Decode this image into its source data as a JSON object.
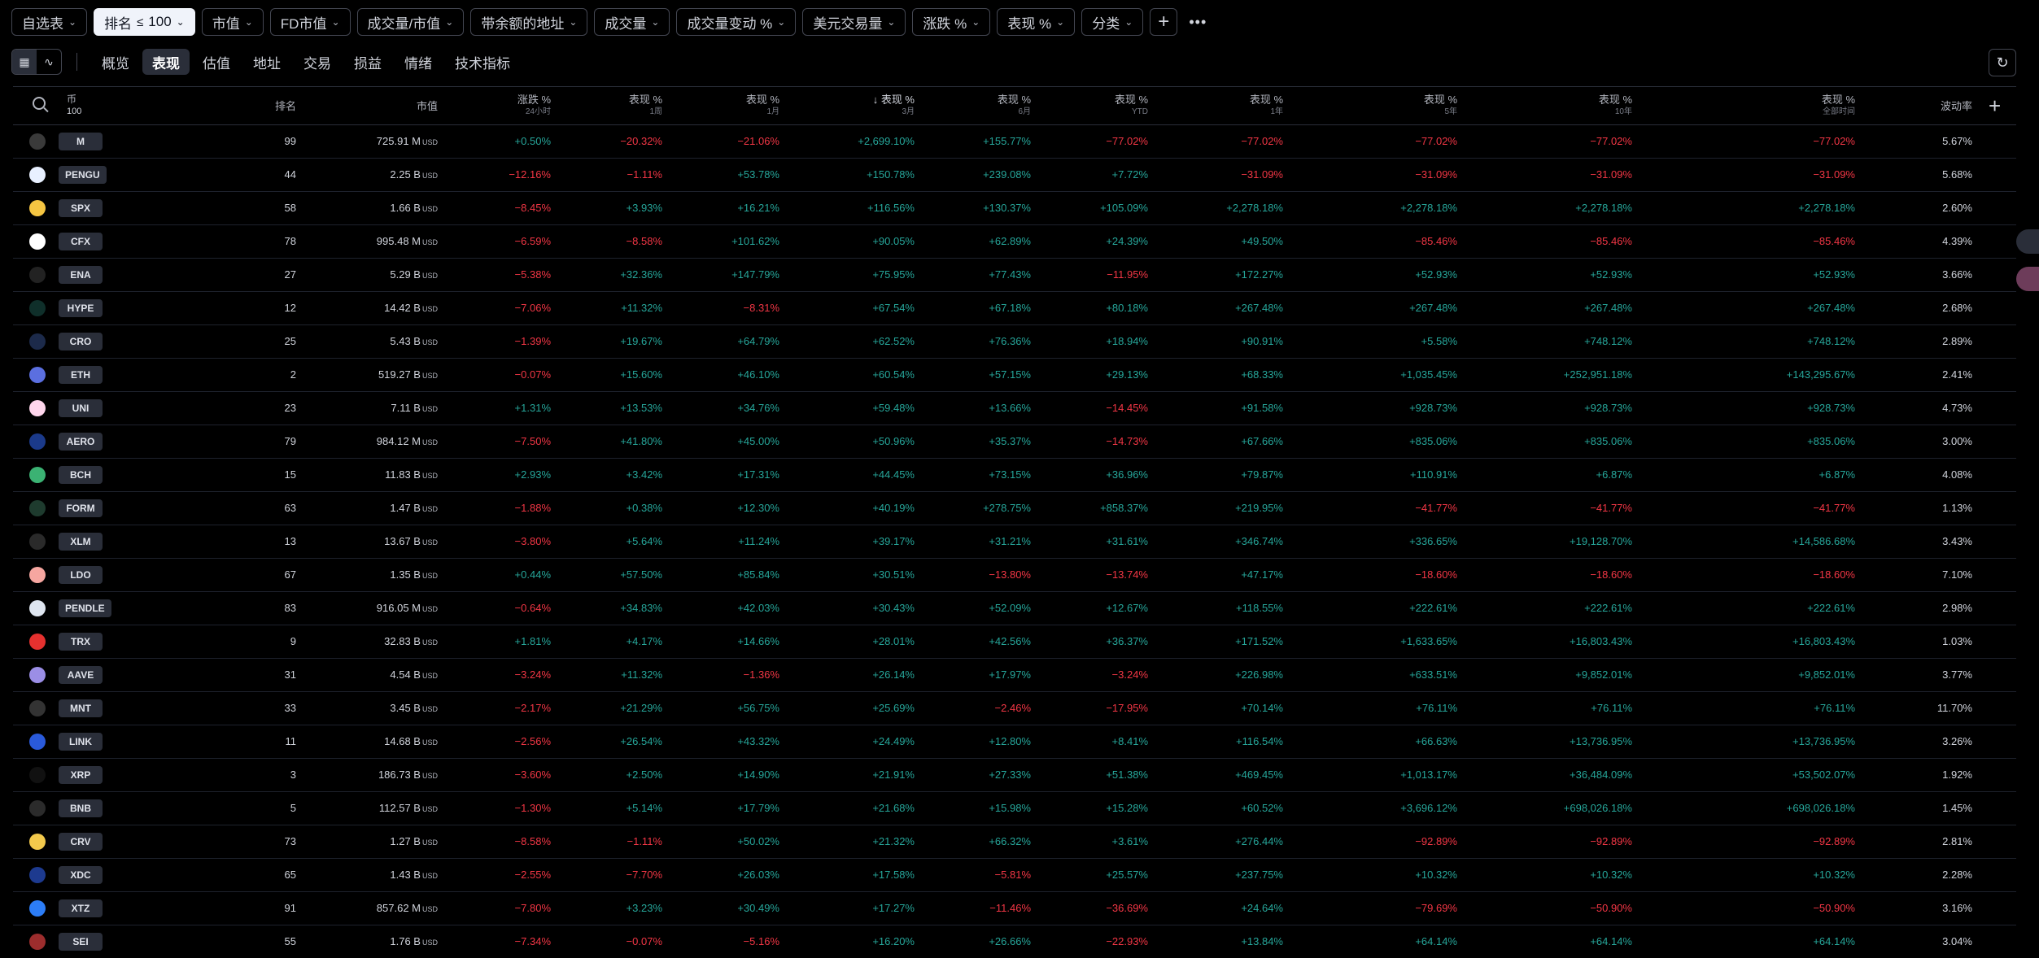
{
  "filters": [
    {
      "key": "watchlist",
      "label": "自选表"
    },
    {
      "key": "rank",
      "label": "排名",
      "sym": "≤",
      "value": "100",
      "active": true
    },
    {
      "key": "mcap",
      "label": "市值"
    },
    {
      "key": "fdv",
      "label": "FD市值"
    },
    {
      "key": "volmcap",
      "label": "成交量/市值"
    },
    {
      "key": "addrbal",
      "label": "带余额的地址"
    },
    {
      "key": "volume",
      "label": "成交量"
    },
    {
      "key": "volchg",
      "label": "成交量变动 %"
    },
    {
      "key": "usdvol",
      "label": "美元交易量"
    },
    {
      "key": "chg",
      "label": "涨跌 %"
    },
    {
      "key": "perf",
      "label": "表现 %"
    },
    {
      "key": "category",
      "label": "分类"
    }
  ],
  "tabs": [
    "概览",
    "表现",
    "估值",
    "地址",
    "交易",
    "损益",
    "情绪",
    "技术指标"
  ],
  "active_tab": 1,
  "headers": {
    "coin": {
      "label": "币",
      "sub": "100"
    },
    "rank": "排名",
    "mcap": "市值",
    "chg": {
      "label": "涨跌 %",
      "sub": "24小时"
    },
    "w1": {
      "label": "表现 %",
      "sub": "1周"
    },
    "m1": {
      "label": "表现 %",
      "sub": "1月"
    },
    "m3": {
      "label": "↓ 表现 %",
      "sub": "3月"
    },
    "m6": {
      "label": "表现 %",
      "sub": "6月"
    },
    "ytd": {
      "label": "表现 %",
      "sub": "YTD"
    },
    "y1": {
      "label": "表现 %",
      "sub": "1年"
    },
    "y5": {
      "label": "表现 %",
      "sub": "5年"
    },
    "y10": {
      "label": "表现 %",
      "sub": "10年"
    },
    "all": {
      "label": "表现 %",
      "sub": "全部时间"
    },
    "vol": "波动率"
  },
  "unit": "USD",
  "rows": [
    {
      "t": "M",
      "c": "#3a3a3a",
      "r": "99",
      "mc": "725.91 M",
      "p": [
        "+0.50%",
        "−20.32%",
        "−21.06%",
        "+2,699.10%",
        "+155.77%",
        "−77.02%",
        "−77.02%",
        "−77.02%",
        "−77.02%",
        "−77.02%"
      ],
      "v": "5.67%"
    },
    {
      "t": "PENGU",
      "c": "#e8f0ff",
      "r": "44",
      "mc": "2.25 B",
      "p": [
        "−12.16%",
        "−1.11%",
        "+53.78%",
        "+150.78%",
        "+239.08%",
        "+7.72%",
        "−31.09%",
        "−31.09%",
        "−31.09%",
        "−31.09%"
      ],
      "v": "5.68%"
    },
    {
      "t": "SPX",
      "c": "#f5c542",
      "r": "58",
      "mc": "1.66 B",
      "p": [
        "−8.45%",
        "+3.93%",
        "+16.21%",
        "+116.56%",
        "+130.37%",
        "+105.09%",
        "+2,278.18%",
        "+2,278.18%",
        "+2,278.18%",
        "+2,278.18%"
      ],
      "v": "2.60%"
    },
    {
      "t": "CFX",
      "c": "#ffffff",
      "r": "78",
      "mc": "995.48 M",
      "p": [
        "−6.59%",
        "−8.58%",
        "+101.62%",
        "+90.05%",
        "+62.89%",
        "+24.39%",
        "+49.50%",
        "−85.46%",
        "−85.46%",
        "−85.46%"
      ],
      "v": "4.39%"
    },
    {
      "t": "ENA",
      "c": "#222222",
      "r": "27",
      "mc": "5.29 B",
      "p": [
        "−5.38%",
        "+32.36%",
        "+147.79%",
        "+75.95%",
        "+77.43%",
        "−11.95%",
        "+172.27%",
        "+52.93%",
        "+52.93%",
        "+52.93%"
      ],
      "v": "3.66%"
    },
    {
      "t": "HYPE",
      "c": "#0f2f2a",
      "r": "12",
      "mc": "14.42 B",
      "p": [
        "−7.06%",
        "+11.32%",
        "−8.31%",
        "+67.54%",
        "+67.18%",
        "+80.18%",
        "+267.48%",
        "+267.48%",
        "+267.48%",
        "+267.48%"
      ],
      "v": "2.68%"
    },
    {
      "t": "CRO",
      "c": "#1c2a4a",
      "r": "25",
      "mc": "5.43 B",
      "p": [
        "−1.39%",
        "+19.67%",
        "+64.79%",
        "+62.52%",
        "+76.36%",
        "+18.94%",
        "+90.91%",
        "+5.58%",
        "+748.12%",
        "+748.12%"
      ],
      "v": "2.89%"
    },
    {
      "t": "ETH",
      "c": "#5b6fe0",
      "r": "2",
      "mc": "519.27 B",
      "p": [
        "−0.07%",
        "+15.60%",
        "+46.10%",
        "+60.54%",
        "+57.15%",
        "+29.13%",
        "+68.33%",
        "+1,035.45%",
        "+252,951.18%",
        "+143,295.67%"
      ],
      "v": "2.41%"
    },
    {
      "t": "UNI",
      "c": "#ffd6ec",
      "r": "23",
      "mc": "7.11 B",
      "p": [
        "+1.31%",
        "+13.53%",
        "+34.76%",
        "+59.48%",
        "+13.66%",
        "−14.45%",
        "+91.58%",
        "+928.73%",
        "+928.73%",
        "+928.73%"
      ],
      "v": "4.73%"
    },
    {
      "t": "AERO",
      "c": "#1b3a8a",
      "r": "79",
      "mc": "984.12 M",
      "p": [
        "−7.50%",
        "+41.80%",
        "+45.00%",
        "+50.96%",
        "+35.37%",
        "−14.73%",
        "+67.66%",
        "+835.06%",
        "+835.06%",
        "+835.06%"
      ],
      "v": "3.00%"
    },
    {
      "t": "BCH",
      "c": "#3bb273",
      "r": "15",
      "mc": "11.83 B",
      "p": [
        "+2.93%",
        "+3.42%",
        "+17.31%",
        "+44.45%",
        "+73.15%",
        "+36.96%",
        "+79.87%",
        "+110.91%",
        "+6.87%",
        "+6.87%"
      ],
      "v": "4.08%"
    },
    {
      "t": "FORM",
      "c": "#1e3b2e",
      "r": "63",
      "mc": "1.47 B",
      "p": [
        "−1.88%",
        "+0.38%",
        "+12.30%",
        "+40.19%",
        "+278.75%",
        "+858.37%",
        "+219.95%",
        "−41.77%",
        "−41.77%",
        "−41.77%"
      ],
      "v": "1.13%"
    },
    {
      "t": "XLM",
      "c": "#2a2a2a",
      "r": "13",
      "mc": "13.67 B",
      "p": [
        "−3.80%",
        "+5.64%",
        "+11.24%",
        "+39.17%",
        "+31.21%",
        "+31.61%",
        "+346.74%",
        "+336.65%",
        "+19,128.70%",
        "+14,586.68%"
      ],
      "v": "3.43%"
    },
    {
      "t": "LDO",
      "c": "#f6a6a0",
      "r": "67",
      "mc": "1.35 B",
      "p": [
        "+0.44%",
        "+57.50%",
        "+85.84%",
        "+30.51%",
        "−13.80%",
        "−13.74%",
        "+47.17%",
        "−18.60%",
        "−18.60%",
        "−18.60%"
      ],
      "v": "7.10%"
    },
    {
      "t": "PENDLE",
      "c": "#dfe6f0",
      "r": "83",
      "mc": "916.05 M",
      "p": [
        "−0.64%",
        "+34.83%",
        "+42.03%",
        "+30.43%",
        "+52.09%",
        "+12.67%",
        "+118.55%",
        "+222.61%",
        "+222.61%",
        "+222.61%"
      ],
      "v": "2.98%"
    },
    {
      "t": "TRX",
      "c": "#e5312f",
      "r": "9",
      "mc": "32.83 B",
      "p": [
        "+1.81%",
        "+4.17%",
        "+14.66%",
        "+28.01%",
        "+42.56%",
        "+36.37%",
        "+171.52%",
        "+1,633.65%",
        "+16,803.43%",
        "+16,803.43%"
      ],
      "v": "1.03%"
    },
    {
      "t": "AAVE",
      "c": "#9b8ee6",
      "r": "31",
      "mc": "4.54 B",
      "p": [
        "−3.24%",
        "+11.32%",
        "−1.36%",
        "+26.14%",
        "+17.97%",
        "−3.24%",
        "+226.98%",
        "+633.51%",
        "+9,852.01%",
        "+9,852.01%"
      ],
      "v": "3.77%"
    },
    {
      "t": "MNT",
      "c": "#333333",
      "r": "33",
      "mc": "3.45 B",
      "p": [
        "−2.17%",
        "+21.29%",
        "+56.75%",
        "+25.69%",
        "−2.46%",
        "−17.95%",
        "+70.14%",
        "+76.11%",
        "+76.11%",
        "+76.11%"
      ],
      "v": "11.70%"
    },
    {
      "t": "LINK",
      "c": "#2a5ada",
      "r": "11",
      "mc": "14.68 B",
      "p": [
        "−2.56%",
        "+26.54%",
        "+43.32%",
        "+24.49%",
        "+12.80%",
        "+8.41%",
        "+116.54%",
        "+66.63%",
        "+13,736.95%",
        "+13,736.95%"
      ],
      "v": "3.26%"
    },
    {
      "t": "XRP",
      "c": "#111111",
      "r": "3",
      "mc": "186.73 B",
      "p": [
        "−3.60%",
        "+2.50%",
        "+14.90%",
        "+21.91%",
        "+27.33%",
        "+51.38%",
        "+469.45%",
        "+1,013.17%",
        "+36,484.09%",
        "+53,502.07%"
      ],
      "v": "1.92%"
    },
    {
      "t": "BNB",
      "c": "#2b2b2b",
      "r": "5",
      "mc": "112.57 B",
      "p": [
        "−1.30%",
        "+5.14%",
        "+17.79%",
        "+21.68%",
        "+15.98%",
        "+15.28%",
        "+60.52%",
        "+3,696.12%",
        "+698,026.18%",
        "+698,026.18%"
      ],
      "v": "1.45%"
    },
    {
      "t": "CRV",
      "c": "#f2c94c",
      "r": "73",
      "mc": "1.27 B",
      "p": [
        "−8.58%",
        "−1.11%",
        "+50.02%",
        "+21.32%",
        "+66.32%",
        "+3.61%",
        "+276.44%",
        "−92.89%",
        "−92.89%",
        "−92.89%"
      ],
      "v": "2.81%"
    },
    {
      "t": "XDC",
      "c": "#1d3a8f",
      "r": "65",
      "mc": "1.43 B",
      "p": [
        "−2.55%",
        "−7.70%",
        "+26.03%",
        "+17.58%",
        "−5.81%",
        "+25.57%",
        "+237.75%",
        "+10.32%",
        "+10.32%",
        "+10.32%"
      ],
      "v": "2.28%"
    },
    {
      "t": "XTZ",
      "c": "#2c7df7",
      "r": "91",
      "mc": "857.62 M",
      "p": [
        "−7.80%",
        "+3.23%",
        "+30.49%",
        "+17.27%",
        "−11.46%",
        "−36.69%",
        "+24.64%",
        "−79.69%",
        "−50.90%",
        "−50.90%"
      ],
      "v": "3.16%"
    },
    {
      "t": "SEI",
      "c": "#9c2d2d",
      "r": "55",
      "mc": "1.76 B",
      "p": [
        "−7.34%",
        "−0.07%",
        "−5.16%",
        "+16.20%",
        "+26.66%",
        "−22.93%",
        "+13.84%",
        "+64.14%",
        "+64.14%",
        "+64.14%"
      ],
      "v": "3.04%"
    }
  ]
}
